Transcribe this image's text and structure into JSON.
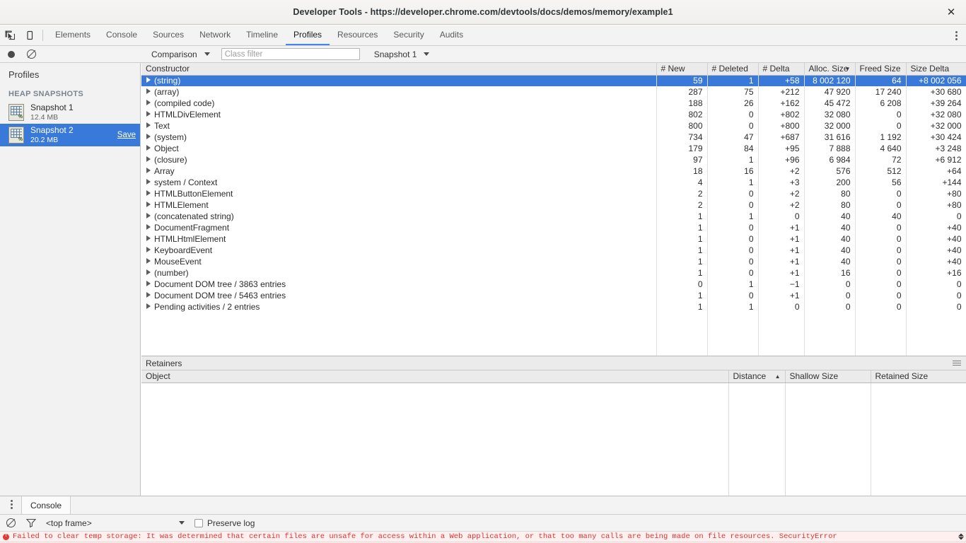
{
  "window": {
    "title": "Developer Tools - https://developer.chrome.com/devtools/docs/demos/memory/example1",
    "close_label": "✕"
  },
  "toolbar": {
    "inspect_icon": "inspect-element-icon",
    "device_icon": "device-toolbar-icon",
    "tabs": [
      {
        "label": "Elements",
        "active": false
      },
      {
        "label": "Console",
        "active": false
      },
      {
        "label": "Sources",
        "active": false
      },
      {
        "label": "Network",
        "active": false
      },
      {
        "label": "Timeline",
        "active": false
      },
      {
        "label": "Profiles",
        "active": true
      },
      {
        "label": "Resources",
        "active": false
      },
      {
        "label": "Security",
        "active": false
      },
      {
        "label": "Audits",
        "active": false
      }
    ],
    "more_icon": "more-vertical-icon"
  },
  "subbar": {
    "record_icon": "record-icon",
    "clear_icon": "clear-icon",
    "view_mode": "Comparison",
    "class_filter_placeholder": "Class filter",
    "class_filter_value": "",
    "baseline_snapshot": "Snapshot 1"
  },
  "sidebar": {
    "title": "Profiles",
    "section_label": "HEAP SNAPSHOTS",
    "snapshots": [
      {
        "name": "Snapshot 1",
        "size": "12.4 MB",
        "selected": false,
        "save_label": ""
      },
      {
        "name": "Snapshot 2",
        "size": "20.2 MB",
        "selected": true,
        "save_label": "Save"
      }
    ]
  },
  "grid": {
    "columns": [
      {
        "label": "Constructor",
        "sort": ""
      },
      {
        "label": "# New",
        "sort": ""
      },
      {
        "label": "# Deleted",
        "sort": ""
      },
      {
        "label": "# Delta",
        "sort": ""
      },
      {
        "label": "Alloc. Size",
        "sort": "▼"
      },
      {
        "label": "Freed Size",
        "sort": ""
      },
      {
        "label": "Size Delta",
        "sort": ""
      }
    ],
    "rows": [
      {
        "ctor": "(string)",
        "new": "59",
        "deleted": "1",
        "delta": "+58",
        "alloc": "8 002 120",
        "freed": "64",
        "sizedelta": "+8 002 056",
        "selected": true
      },
      {
        "ctor": "(array)",
        "new": "287",
        "deleted": "75",
        "delta": "+212",
        "alloc": "47 920",
        "freed": "17 240",
        "sizedelta": "+30 680",
        "selected": false
      },
      {
        "ctor": "(compiled code)",
        "new": "188",
        "deleted": "26",
        "delta": "+162",
        "alloc": "45 472",
        "freed": "6 208",
        "sizedelta": "+39 264",
        "selected": false
      },
      {
        "ctor": "HTMLDivElement",
        "new": "802",
        "deleted": "0",
        "delta": "+802",
        "alloc": "32 080",
        "freed": "0",
        "sizedelta": "+32 080",
        "selected": false
      },
      {
        "ctor": "Text",
        "new": "800",
        "deleted": "0",
        "delta": "+800",
        "alloc": "32 000",
        "freed": "0",
        "sizedelta": "+32 000",
        "selected": false
      },
      {
        "ctor": "(system)",
        "new": "734",
        "deleted": "47",
        "delta": "+687",
        "alloc": "31 616",
        "freed": "1 192",
        "sizedelta": "+30 424",
        "selected": false
      },
      {
        "ctor": "Object",
        "new": "179",
        "deleted": "84",
        "delta": "+95",
        "alloc": "7 888",
        "freed": "4 640",
        "sizedelta": "+3 248",
        "selected": false
      },
      {
        "ctor": "(closure)",
        "new": "97",
        "deleted": "1",
        "delta": "+96",
        "alloc": "6 984",
        "freed": "72",
        "sizedelta": "+6 912",
        "selected": false
      },
      {
        "ctor": "Array",
        "new": "18",
        "deleted": "16",
        "delta": "+2",
        "alloc": "576",
        "freed": "512",
        "sizedelta": "+64",
        "selected": false
      },
      {
        "ctor": "system / Context",
        "new": "4",
        "deleted": "1",
        "delta": "+3",
        "alloc": "200",
        "freed": "56",
        "sizedelta": "+144",
        "selected": false
      },
      {
        "ctor": "HTMLButtonElement",
        "new": "2",
        "deleted": "0",
        "delta": "+2",
        "alloc": "80",
        "freed": "0",
        "sizedelta": "+80",
        "selected": false
      },
      {
        "ctor": "HTMLElement",
        "new": "2",
        "deleted": "0",
        "delta": "+2",
        "alloc": "80",
        "freed": "0",
        "sizedelta": "+80",
        "selected": false
      },
      {
        "ctor": "(concatenated string)",
        "new": "1",
        "deleted": "1",
        "delta": "0",
        "alloc": "40",
        "freed": "40",
        "sizedelta": "0",
        "selected": false
      },
      {
        "ctor": "DocumentFragment",
        "new": "1",
        "deleted": "0",
        "delta": "+1",
        "alloc": "40",
        "freed": "0",
        "sizedelta": "+40",
        "selected": false
      },
      {
        "ctor": "HTMLHtmlElement",
        "new": "1",
        "deleted": "0",
        "delta": "+1",
        "alloc": "40",
        "freed": "0",
        "sizedelta": "+40",
        "selected": false
      },
      {
        "ctor": "KeyboardEvent",
        "new": "1",
        "deleted": "0",
        "delta": "+1",
        "alloc": "40",
        "freed": "0",
        "sizedelta": "+40",
        "selected": false
      },
      {
        "ctor": "MouseEvent",
        "new": "1",
        "deleted": "0",
        "delta": "+1",
        "alloc": "40",
        "freed": "0",
        "sizedelta": "+40",
        "selected": false
      },
      {
        "ctor": "(number)",
        "new": "1",
        "deleted": "0",
        "delta": "+1",
        "alloc": "16",
        "freed": "0",
        "sizedelta": "+16",
        "selected": false
      },
      {
        "ctor": "Document DOM tree / 3863 entries",
        "new": "0",
        "deleted": "1",
        "delta": "−1",
        "alloc": "0",
        "freed": "0",
        "sizedelta": "0",
        "selected": false
      },
      {
        "ctor": "Document DOM tree / 5463 entries",
        "new": "1",
        "deleted": "0",
        "delta": "+1",
        "alloc": "0",
        "freed": "0",
        "sizedelta": "0",
        "selected": false
      },
      {
        "ctor": "Pending activities / 2 entries",
        "new": "1",
        "deleted": "1",
        "delta": "0",
        "alloc": "0",
        "freed": "0",
        "sizedelta": "0",
        "selected": false
      }
    ]
  },
  "retainers": {
    "title": "Retainers",
    "menu_icon": "hamburger-menu-icon",
    "columns": [
      {
        "label": "Object",
        "sort": ""
      },
      {
        "label": "Distance",
        "sort": "▲"
      },
      {
        "label": "Shallow Size",
        "sort": ""
      },
      {
        "label": "Retained Size",
        "sort": ""
      }
    ],
    "rows": []
  },
  "drawer": {
    "more_icon": "more-vertical-icon",
    "tab_label": "Console",
    "clear_icon": "clear-console-icon",
    "filter_icon": "filter-icon",
    "frame": "<top frame>",
    "preserve_log_label": "Preserve log",
    "preserve_log_checked": false,
    "message": "Failed to clear temp storage: It was determined that certain files are unsafe for access within a Web application, or that too many calls are being made on file resources. SecurityError",
    "message_level": "error"
  },
  "colors": {
    "accent": "#3879d9",
    "tab_underline": "#4285f4",
    "error": "#e03131",
    "error_bg": "#fff0f0",
    "header_bg": "#ebebeb",
    "sidebar_bg": "#f2f2f2"
  }
}
